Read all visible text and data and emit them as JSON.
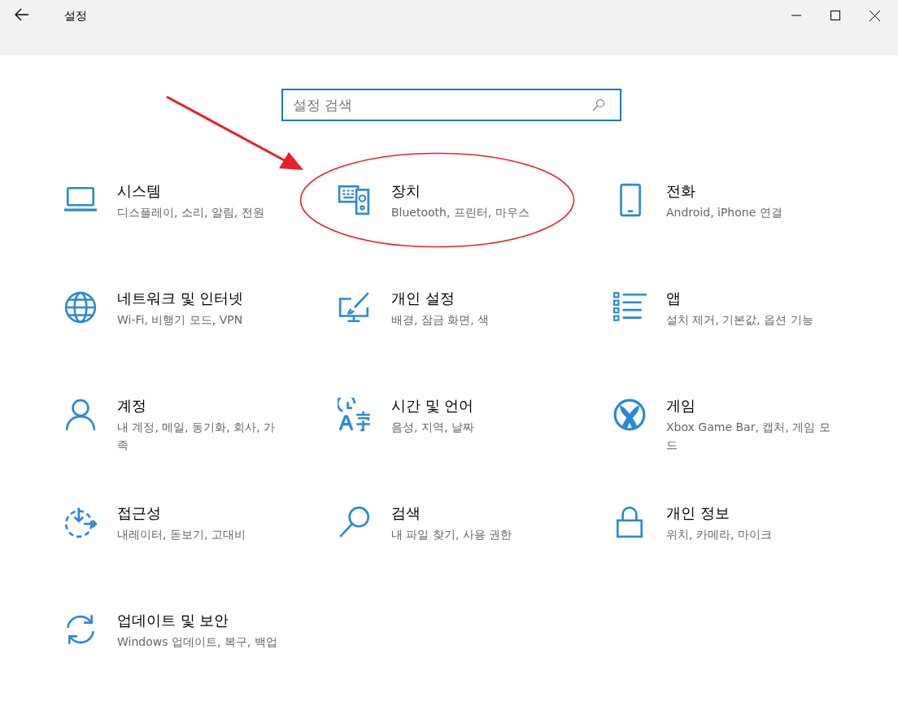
{
  "window": {
    "title": "설정"
  },
  "search": {
    "placeholder": "설정 검색"
  },
  "categories": [
    {
      "title": "시스템",
      "description": "디스플레이, 소리, 알림, 전원",
      "highlighted": false
    },
    {
      "title": "장치",
      "description": "Bluetooth, 프린터, 마우스",
      "highlighted": true
    },
    {
      "title": "전화",
      "description": "Android, iPhone 연결",
      "highlighted": false
    },
    {
      "title": "네트워크 및 인터넷",
      "description": "Wi-Fi, 비행기 모드, VPN",
      "highlighted": false
    },
    {
      "title": "개인 설정",
      "description": "배경, 잠금 화면, 색",
      "highlighted": false
    },
    {
      "title": "앱",
      "description": "설치 제거, 기본값, 옵션 기능",
      "highlighted": false
    },
    {
      "title": "계정",
      "description": "내 계정, 메일, 동기화, 회사, 가족",
      "highlighted": false
    },
    {
      "title": "시간 및 언어",
      "description": "음성, 지역, 날짜",
      "highlighted": false
    },
    {
      "title": "게임",
      "description": "Xbox Game Bar, 캡처, 게임 모드",
      "highlighted": false
    },
    {
      "title": "접근성",
      "description": "내레이터, 돋보기, 고대비",
      "highlighted": false
    },
    {
      "title": "검색",
      "description": "내 파일 찾기, 사용 권한",
      "highlighted": false
    },
    {
      "title": "개인 정보",
      "description": "위치, 카메라, 마이크",
      "highlighted": false
    },
    {
      "title": "업데이트 및 보안",
      "description": "Windows 업데이트, 복구, 백업",
      "highlighted": false
    }
  ]
}
